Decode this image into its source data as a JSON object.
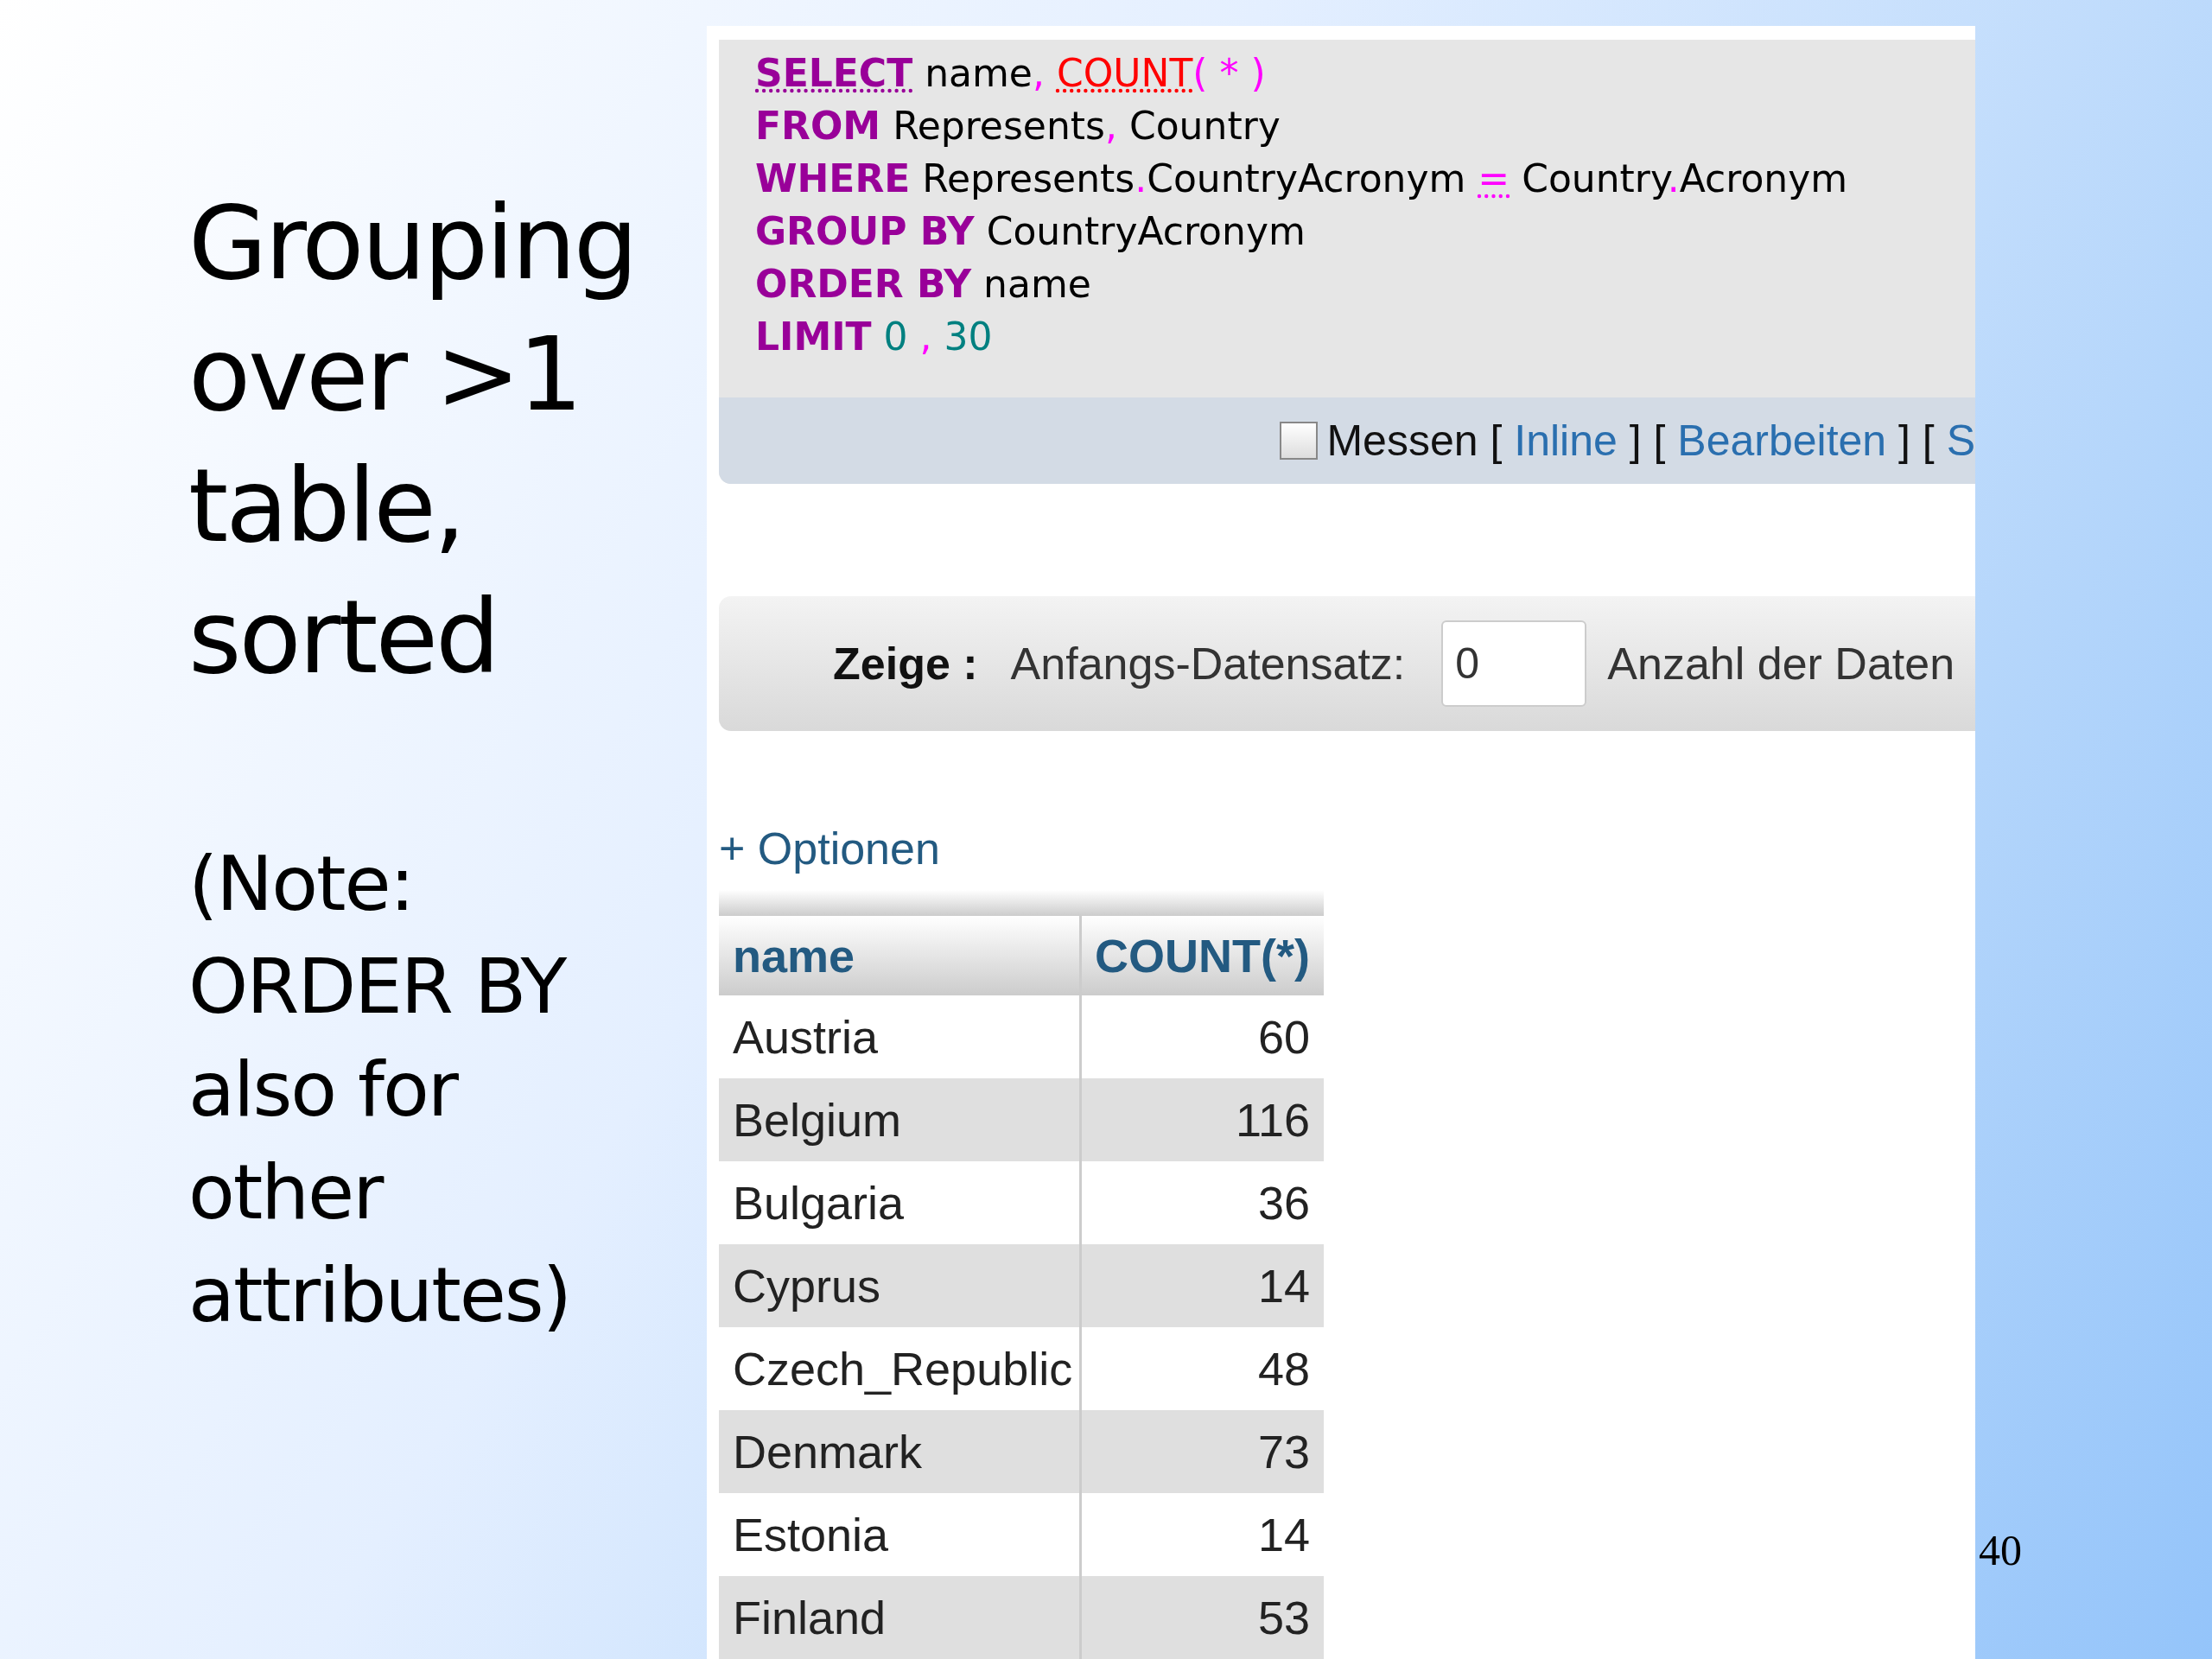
{
  "slide": {
    "title": "Grouping\nover >1\ntable,\nsorted",
    "note": "(Note:\nORDER BY\nalso for\nother\nattributes)",
    "page_number": "40"
  },
  "sql_query": {
    "lines": [
      [
        {
          "text": "SELECT",
          "kind": "keyword",
          "underlined": true
        },
        {
          "text": " name",
          "kind": "plain"
        },
        {
          "text": ", ",
          "kind": "punct"
        },
        {
          "text": "COUNT",
          "kind": "function",
          "underlined": true
        },
        {
          "text": "( * )",
          "kind": "punct"
        }
      ],
      [
        {
          "text": "FROM",
          "kind": "keyword"
        },
        {
          "text": " Represents",
          "kind": "plain"
        },
        {
          "text": ", ",
          "kind": "punct"
        },
        {
          "text": "Country",
          "kind": "plain"
        }
      ],
      [
        {
          "text": "WHERE",
          "kind": "keyword"
        },
        {
          "text": " Represents",
          "kind": "plain"
        },
        {
          "text": ".",
          "kind": "punct"
        },
        {
          "text": "CountryAcronym ",
          "kind": "plain"
        },
        {
          "text": "=",
          "kind": "punct",
          "underlined": true
        },
        {
          "text": " Country",
          "kind": "plain"
        },
        {
          "text": ".",
          "kind": "punct"
        },
        {
          "text": "Acronym",
          "kind": "plain"
        }
      ],
      [
        {
          "text": "GROUP BY",
          "kind": "keyword"
        },
        {
          "text": " CountryAcronym",
          "kind": "plain"
        }
      ],
      [
        {
          "text": "ORDER BY",
          "kind": "keyword"
        },
        {
          "text": " name",
          "kind": "plain"
        }
      ],
      [
        {
          "text": "LIMIT",
          "kind": "keyword"
        },
        {
          "text": " 0",
          "kind": "number"
        },
        {
          "text": " , ",
          "kind": "punct"
        },
        {
          "text": "30",
          "kind": "number"
        }
      ]
    ]
  },
  "query_actions": {
    "checkbox": {
      "label": "Messen",
      "checked": false
    },
    "items": [
      {
        "text": "[ ",
        "kind": "bracket"
      },
      {
        "text": "Inline",
        "kind": "link"
      },
      {
        "text": " ] [ ",
        "kind": "bracket"
      },
      {
        "text": "Bearbeiten",
        "kind": "link"
      },
      {
        "text": " ] [ ",
        "kind": "bracket"
      },
      {
        "text": "S",
        "kind": "link"
      }
    ]
  },
  "navigation": {
    "label": "Zeige :",
    "start_label": "Anfangs-Datensatz:",
    "start_value": "0",
    "count_label": "Anzahl der Daten"
  },
  "options_link": "+ Optionen",
  "table": {
    "columns": [
      "name",
      "COUNT(*)"
    ],
    "rows": [
      [
        "Austria",
        "60"
      ],
      [
        "Belgium",
        "116"
      ],
      [
        "Bulgaria",
        "36"
      ],
      [
        "Cyprus",
        "14"
      ],
      [
        "Czech_Republic",
        "48"
      ],
      [
        "Denmark",
        "73"
      ],
      [
        "Estonia",
        "14"
      ],
      [
        "Finland",
        "53"
      ]
    ]
  }
}
